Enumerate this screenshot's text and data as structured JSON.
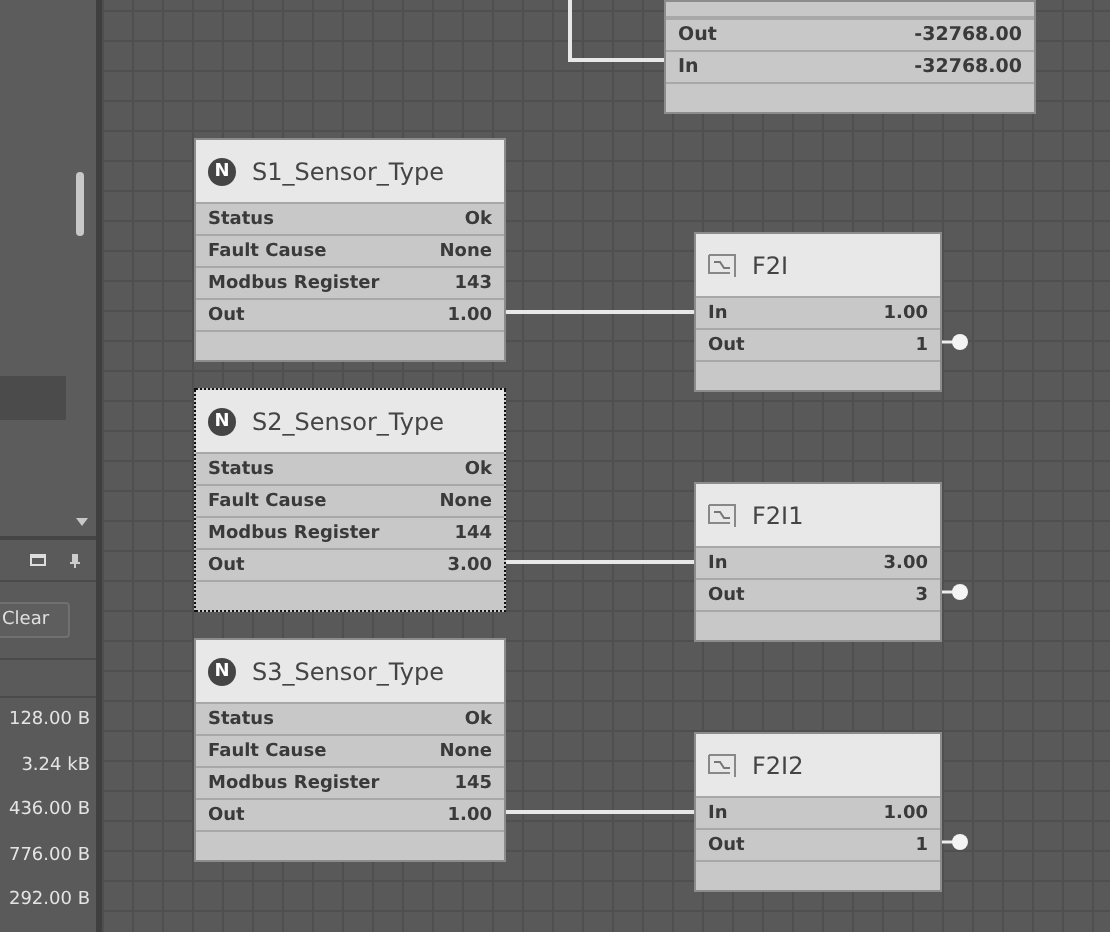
{
  "side_panel": {
    "clear_button": "Clear",
    "sizes": [
      "128.00 B",
      "3.24 kB",
      "436.00 B",
      "776.00 B",
      "292.00 B"
    ]
  },
  "nodes": [
    {
      "kind": "cut",
      "selected": false,
      "rows": [
        {
          "label": "Out",
          "value": "-32768.00"
        },
        {
          "label": "In",
          "value": "-32768.00"
        }
      ]
    },
    {
      "kind": "sensor",
      "badge": "N",
      "title": "S1_Sensor_Type",
      "selected": false,
      "rows": [
        {
          "label": "Status",
          "value": "Ok"
        },
        {
          "label": "Fault Cause",
          "value": "None"
        },
        {
          "label": "Modbus Register",
          "value": "143"
        },
        {
          "label": "Out",
          "value": "1.00"
        }
      ]
    },
    {
      "kind": "function",
      "title": "F2I",
      "selected": false,
      "rows": [
        {
          "label": "In",
          "value": "1.00"
        },
        {
          "label": "Out",
          "value": "1"
        }
      ]
    },
    {
      "kind": "sensor",
      "badge": "N",
      "title": "S2_Sensor_Type",
      "selected": true,
      "rows": [
        {
          "label": "Status",
          "value": "Ok"
        },
        {
          "label": "Fault Cause",
          "value": "None"
        },
        {
          "label": "Modbus Register",
          "value": "144"
        },
        {
          "label": "Out",
          "value": "3.00"
        }
      ]
    },
    {
      "kind": "function",
      "title": "F2I1",
      "selected": false,
      "rows": [
        {
          "label": "In",
          "value": "3.00"
        },
        {
          "label": "Out",
          "value": "3"
        }
      ]
    },
    {
      "kind": "sensor",
      "badge": "N",
      "title": "S3_Sensor_Type",
      "selected": false,
      "rows": [
        {
          "label": "Status",
          "value": "Ok"
        },
        {
          "label": "Fault Cause",
          "value": "None"
        },
        {
          "label": "Modbus Register",
          "value": "145"
        },
        {
          "label": "Out",
          "value": "1.00"
        }
      ]
    },
    {
      "kind": "function",
      "title": "F2I2",
      "selected": false,
      "rows": [
        {
          "label": "In",
          "value": "1.00"
        },
        {
          "label": "Out",
          "value": "1"
        }
      ]
    }
  ]
}
